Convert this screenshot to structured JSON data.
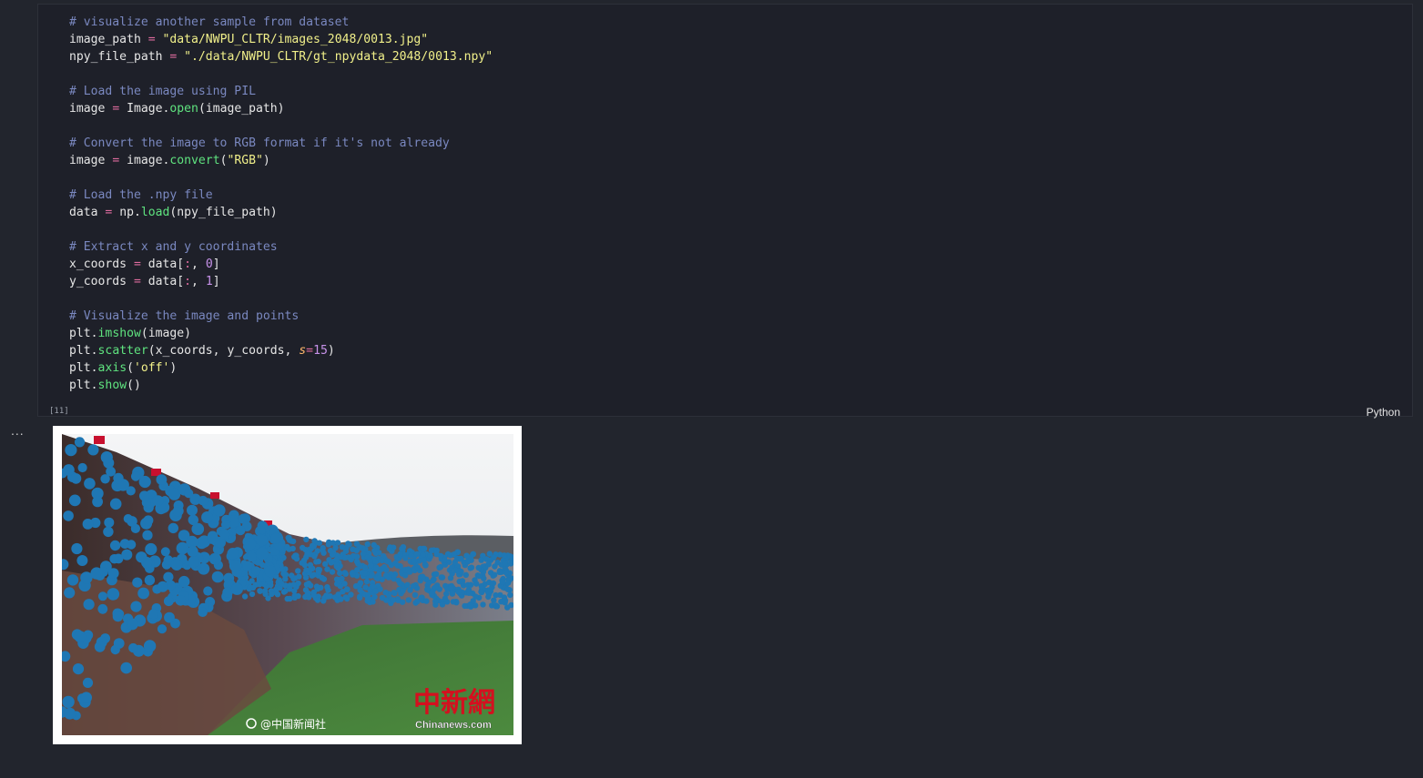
{
  "cell": {
    "execution_count": "[11]",
    "language": "Python",
    "code_lines": [
      [
        {
          "t": "# visualize another sample from dataset",
          "c": "cm"
        }
      ],
      [
        {
          "t": "image_path "
        },
        {
          "t": "=",
          "c": "op"
        },
        {
          "t": " "
        },
        {
          "t": "\"data/NWPU_CLTR/images_2048/0013.jpg\"",
          "c": "st"
        }
      ],
      [
        {
          "t": "npy_file_path "
        },
        {
          "t": "=",
          "c": "op"
        },
        {
          "t": " "
        },
        {
          "t": "\"./data/NWPU_CLTR/gt_npydata_2048/0013.npy\"",
          "c": "st"
        }
      ],
      [],
      [
        {
          "t": "# Load the image using PIL",
          "c": "cm"
        }
      ],
      [
        {
          "t": "image "
        },
        {
          "t": "=",
          "c": "op"
        },
        {
          "t": " Image."
        },
        {
          "t": "open",
          "c": "fn"
        },
        {
          "t": "(image_path)"
        }
      ],
      [],
      [
        {
          "t": "# Convert the image to RGB format if it's not already",
          "c": "cm"
        }
      ],
      [
        {
          "t": "image "
        },
        {
          "t": "=",
          "c": "op"
        },
        {
          "t": " image."
        },
        {
          "t": "convert",
          "c": "fn"
        },
        {
          "t": "("
        },
        {
          "t": "\"RGB\"",
          "c": "st"
        },
        {
          "t": ")"
        }
      ],
      [],
      [
        {
          "t": "# Load the .npy file",
          "c": "cm"
        }
      ],
      [
        {
          "t": "data "
        },
        {
          "t": "=",
          "c": "op"
        },
        {
          "t": " np."
        },
        {
          "t": "load",
          "c": "fn"
        },
        {
          "t": "(npy_file_path)"
        }
      ],
      [],
      [
        {
          "t": "# Extract x and y coordinates",
          "c": "cm"
        }
      ],
      [
        {
          "t": "x_coords "
        },
        {
          "t": "=",
          "c": "op"
        },
        {
          "t": " data["
        },
        {
          "t": ":",
          "c": "op"
        },
        {
          "t": ", "
        },
        {
          "t": "0",
          "c": "nu"
        },
        {
          "t": "]"
        }
      ],
      [
        {
          "t": "y_coords "
        },
        {
          "t": "=",
          "c": "op"
        },
        {
          "t": " data["
        },
        {
          "t": ":",
          "c": "op"
        },
        {
          "t": ", "
        },
        {
          "t": "1",
          "c": "nu"
        },
        {
          "t": "]"
        }
      ],
      [],
      [
        {
          "t": "# Visualize the image and points",
          "c": "cm"
        }
      ],
      [
        {
          "t": "plt."
        },
        {
          "t": "imshow",
          "c": "fn"
        },
        {
          "t": "(image)"
        }
      ],
      [
        {
          "t": "plt."
        },
        {
          "t": "scatter",
          "c": "fn"
        },
        {
          "t": "(x_coords, y_coords, "
        },
        {
          "t": "s",
          "c": "kw"
        },
        {
          "t": "=",
          "c": "op"
        },
        {
          "t": "15",
          "c": "nu"
        },
        {
          "t": ")"
        }
      ],
      [
        {
          "t": "plt."
        },
        {
          "t": "axis",
          "c": "fn"
        },
        {
          "t": "("
        },
        {
          "t": "'off'",
          "c": "st"
        },
        {
          "t": ")"
        }
      ],
      [
        {
          "t": "plt."
        },
        {
          "t": "show",
          "c": "fn"
        },
        {
          "t": "()"
        }
      ]
    ]
  },
  "output": {
    "menu_label": "...",
    "watermark_left": "@中国新闻社",
    "logo_cn": "中新網",
    "logo_en": "Chinanews.com",
    "colors": {
      "points": "#1f77b4",
      "sky": "#eef0f2",
      "field": "#3f7a36"
    }
  }
}
